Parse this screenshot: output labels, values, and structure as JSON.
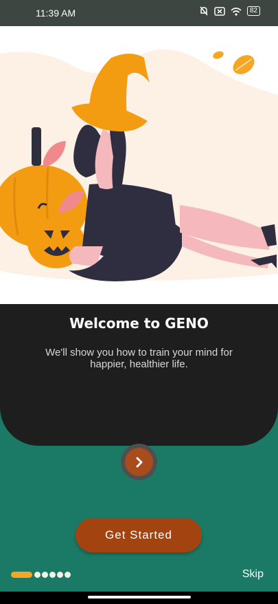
{
  "status_bar": {
    "time": "11:39 AM",
    "battery": "82"
  },
  "hero": {
    "illustration": "witch-with-pumpkins"
  },
  "onboarding": {
    "title": "Welcome to GENO",
    "subtitle": "We'll show you how to train your mind for happier, healthier life."
  },
  "actions": {
    "get_started": "Get Started",
    "skip": "Skip",
    "next_icon": "chevron-right-icon"
  },
  "pager": {
    "current": 1,
    "total": 6
  },
  "colors": {
    "accent": "#a3430f",
    "indicator": "#f6a623",
    "background": "#1b7a66",
    "card": "#1f1e1f"
  }
}
